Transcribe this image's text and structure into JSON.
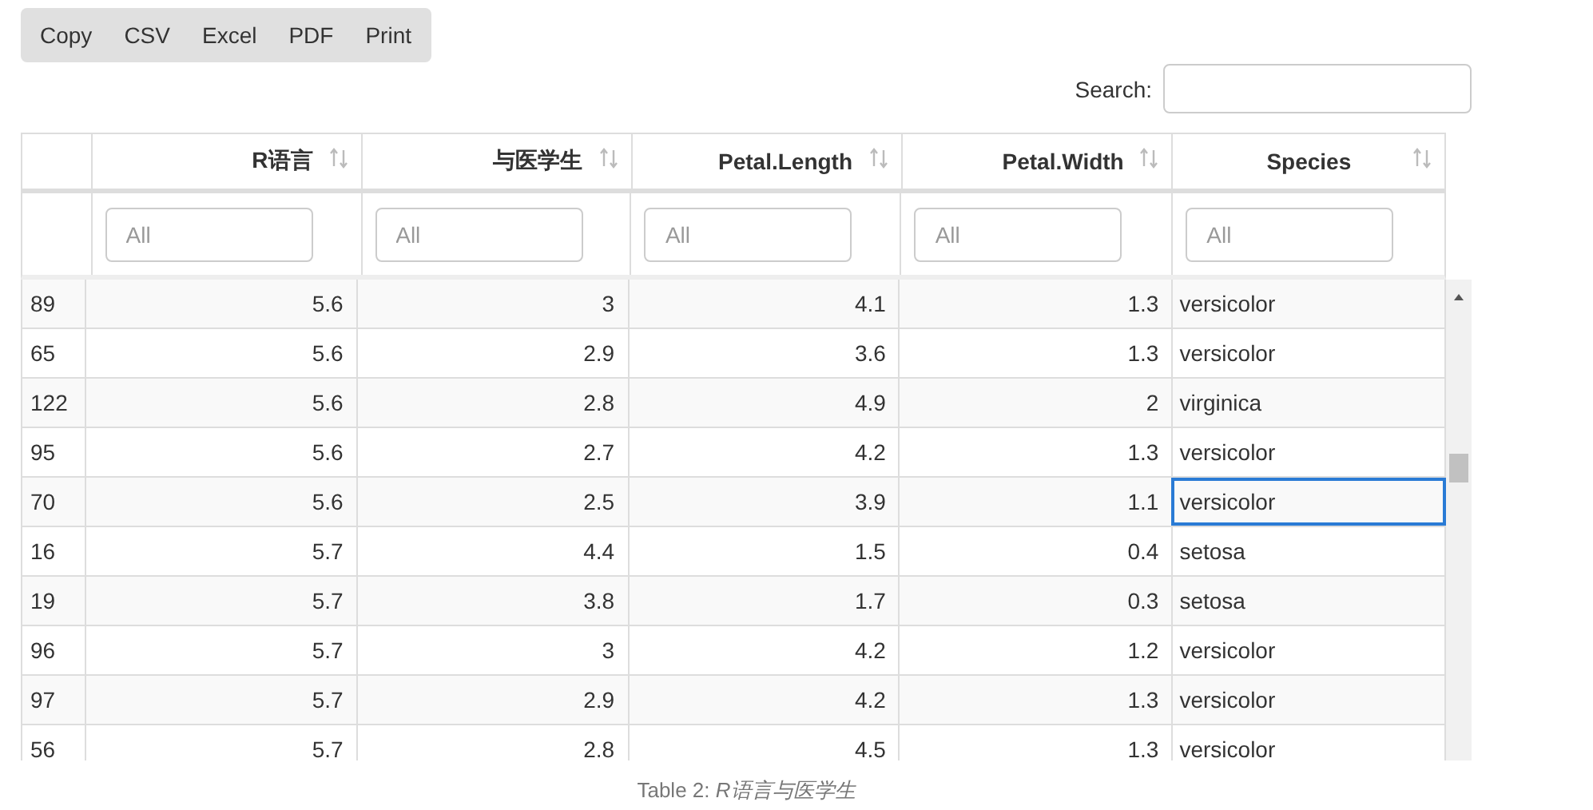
{
  "buttons": [
    "Copy",
    "CSV",
    "Excel",
    "PDF",
    "Print"
  ],
  "search": {
    "label": "Search:"
  },
  "table": {
    "columns": [
      {
        "label": "R语言"
      },
      {
        "label": "与医学生"
      },
      {
        "label": "Petal.Length"
      },
      {
        "label": "Petal.Width"
      },
      {
        "label": "Species"
      }
    ],
    "filters": [
      {
        "placeholder": "All"
      },
      {
        "placeholder": "All"
      },
      {
        "placeholder": "All"
      },
      {
        "placeholder": "All"
      },
      {
        "placeholder": "All"
      }
    ],
    "rows": [
      {
        "name": "89",
        "values": [
          "5.6",
          "3",
          "4.1",
          "1.3",
          "versicolor"
        ],
        "focused": false
      },
      {
        "name": "65",
        "values": [
          "5.6",
          "2.9",
          "3.6",
          "1.3",
          "versicolor"
        ],
        "focused": false
      },
      {
        "name": "122",
        "values": [
          "5.6",
          "2.8",
          "4.9",
          "2",
          "virginica"
        ],
        "focused": false
      },
      {
        "name": "95",
        "values": [
          "5.6",
          "2.7",
          "4.2",
          "1.3",
          "versicolor"
        ],
        "focused": false
      },
      {
        "name": "70",
        "values": [
          "5.6",
          "2.5",
          "3.9",
          "1.1",
          "versicolor"
        ],
        "focused": true
      },
      {
        "name": "16",
        "values": [
          "5.7",
          "4.4",
          "1.5",
          "0.4",
          "setosa"
        ],
        "focused": false
      },
      {
        "name": "19",
        "values": [
          "5.7",
          "3.8",
          "1.7",
          "0.3",
          "setosa"
        ],
        "focused": false
      },
      {
        "name": "96",
        "values": [
          "5.7",
          "3",
          "4.2",
          "1.2",
          "versicolor"
        ],
        "focused": false
      },
      {
        "name": "97",
        "values": [
          "5.7",
          "2.9",
          "4.2",
          "1.3",
          "versicolor"
        ],
        "focused": false
      },
      {
        "name": "56",
        "values": [
          "5.7",
          "2.8",
          "4.5",
          "1.3",
          "versicolor"
        ],
        "focused": false
      }
    ]
  },
  "caption": "Table 2: *R语言与医学生*"
}
